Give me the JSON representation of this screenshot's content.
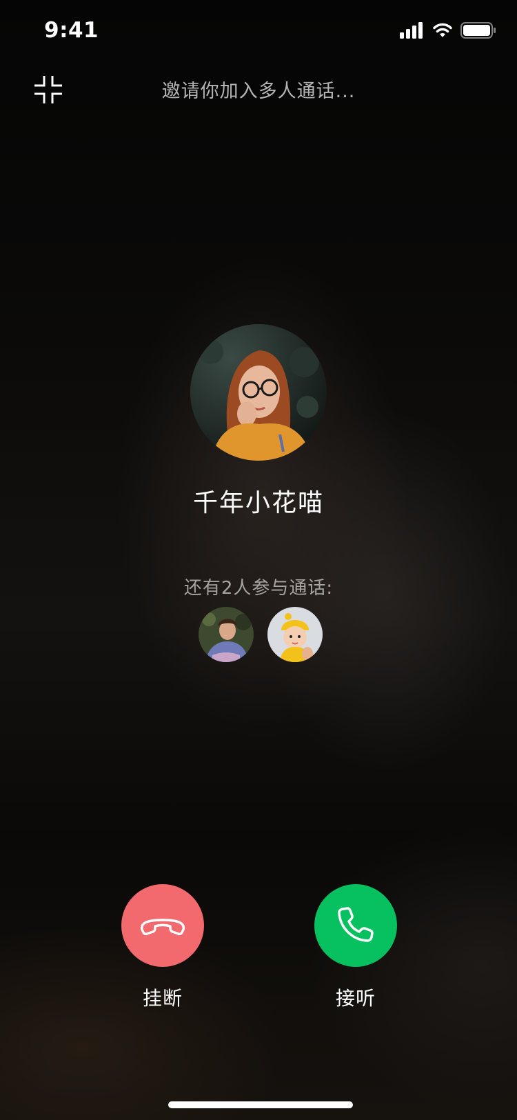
{
  "status_bar": {
    "time": "9:41"
  },
  "header": {
    "invite_text": "邀请你加入多人通话..."
  },
  "caller": {
    "name": "千年小花喵"
  },
  "participants": {
    "label": "还有2人参与通话:"
  },
  "actions": {
    "hangup_label": "挂断",
    "accept_label": "接听"
  },
  "colors": {
    "hangup": "#f26a6e",
    "accept": "#07c160"
  }
}
